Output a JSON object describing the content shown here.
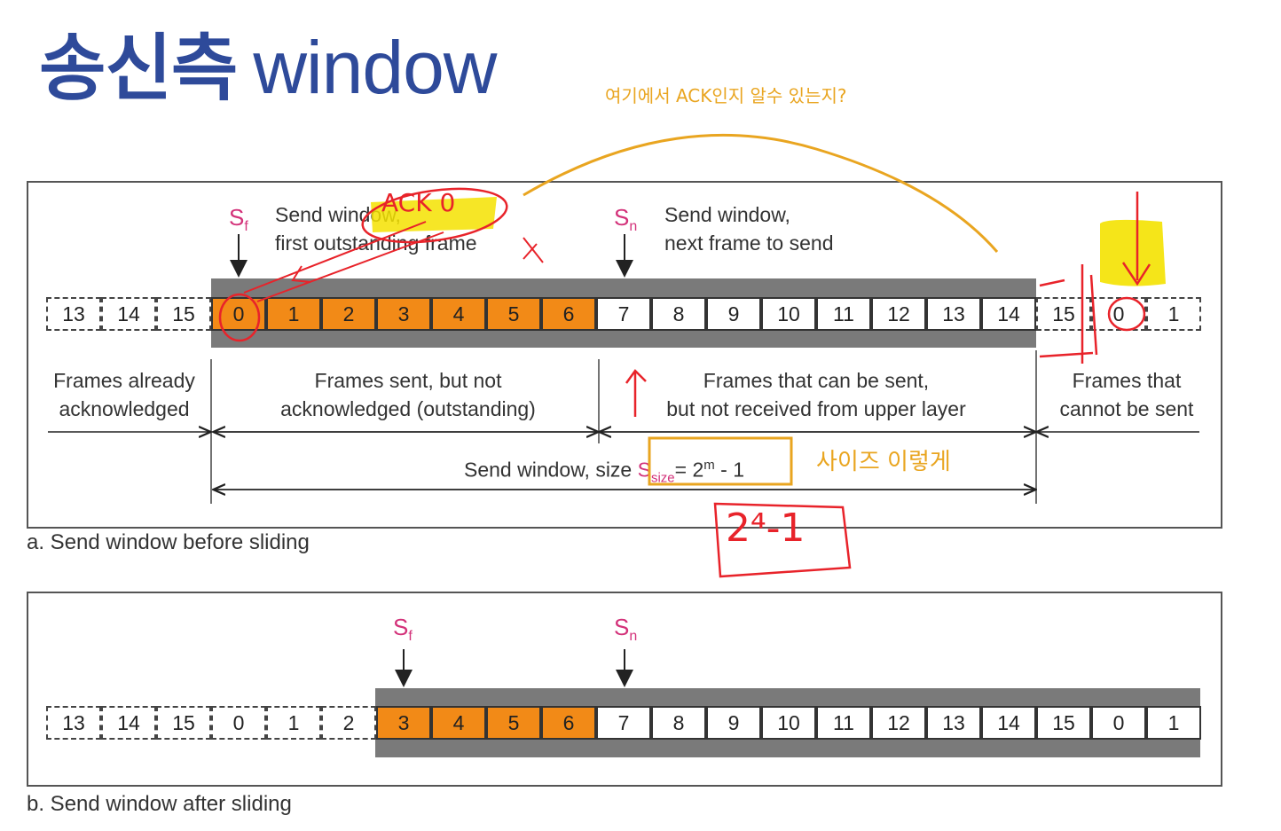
{
  "title": {
    "ko": "송신측",
    "en": "window"
  },
  "handnote_top": "여기에서 ACK인지 알수 있는지?",
  "handnote_size": "사이즈 이렇게",
  "handnote_formula": "2⁴-1",
  "handnote_ack": "ACK 0",
  "panel_a": {
    "caption": "a. Send window before sliding",
    "sf_label": "S",
    "sf_sub": "f",
    "sn_label": "S",
    "sn_sub": "n",
    "sf_desc_1": "Send window,",
    "sf_desc_2": "first outstanding frame",
    "sn_desc_1": "Send window,",
    "sn_desc_2": "next frame to send",
    "cells_left": [
      "13",
      "14",
      "15"
    ],
    "cells_out": [
      "0",
      "1",
      "2",
      "3",
      "4",
      "5",
      "6"
    ],
    "cells_win": [
      "7",
      "8",
      "9",
      "10",
      "11",
      "12",
      "13",
      "14"
    ],
    "cells_right": [
      "15",
      "0",
      "1"
    ],
    "region_1_a": "Frames already",
    "region_1_b": "acknowledged",
    "region_2_a": "Frames sent, but not",
    "region_2_b": "acknowledged (outstanding)",
    "region_3_a": "Frames that can be sent,",
    "region_3_b": "but not received from upper layer",
    "region_4_a": "Frames that",
    "region_4_b": "cannot be sent",
    "size_text": "Send window, size",
    "size_sym": "S",
    "size_sub": "size",
    "size_eq": "= 2",
    "size_exp": "m",
    "size_tail": " - 1"
  },
  "panel_b": {
    "caption": "b. Send window after sliding",
    "sf_label": "S",
    "sf_sub": "f",
    "sn_label": "S",
    "sn_sub": "n",
    "cells_left": [
      "13",
      "14",
      "15",
      "0",
      "1",
      "2"
    ],
    "cells_out": [
      "3",
      "4",
      "5",
      "6"
    ],
    "cells_win": [
      "7",
      "8",
      "9",
      "10",
      "11",
      "12",
      "13",
      "14",
      "15",
      "0",
      "1"
    ]
  },
  "colors": {
    "title": "#2e4a9a",
    "outstanding": "#f28a17",
    "pointer": "#d3327a",
    "band": "#7a7a7a",
    "pen_orange": "#e9a520",
    "pen_red": "#e8232a",
    "highlight": "#f4e200"
  }
}
